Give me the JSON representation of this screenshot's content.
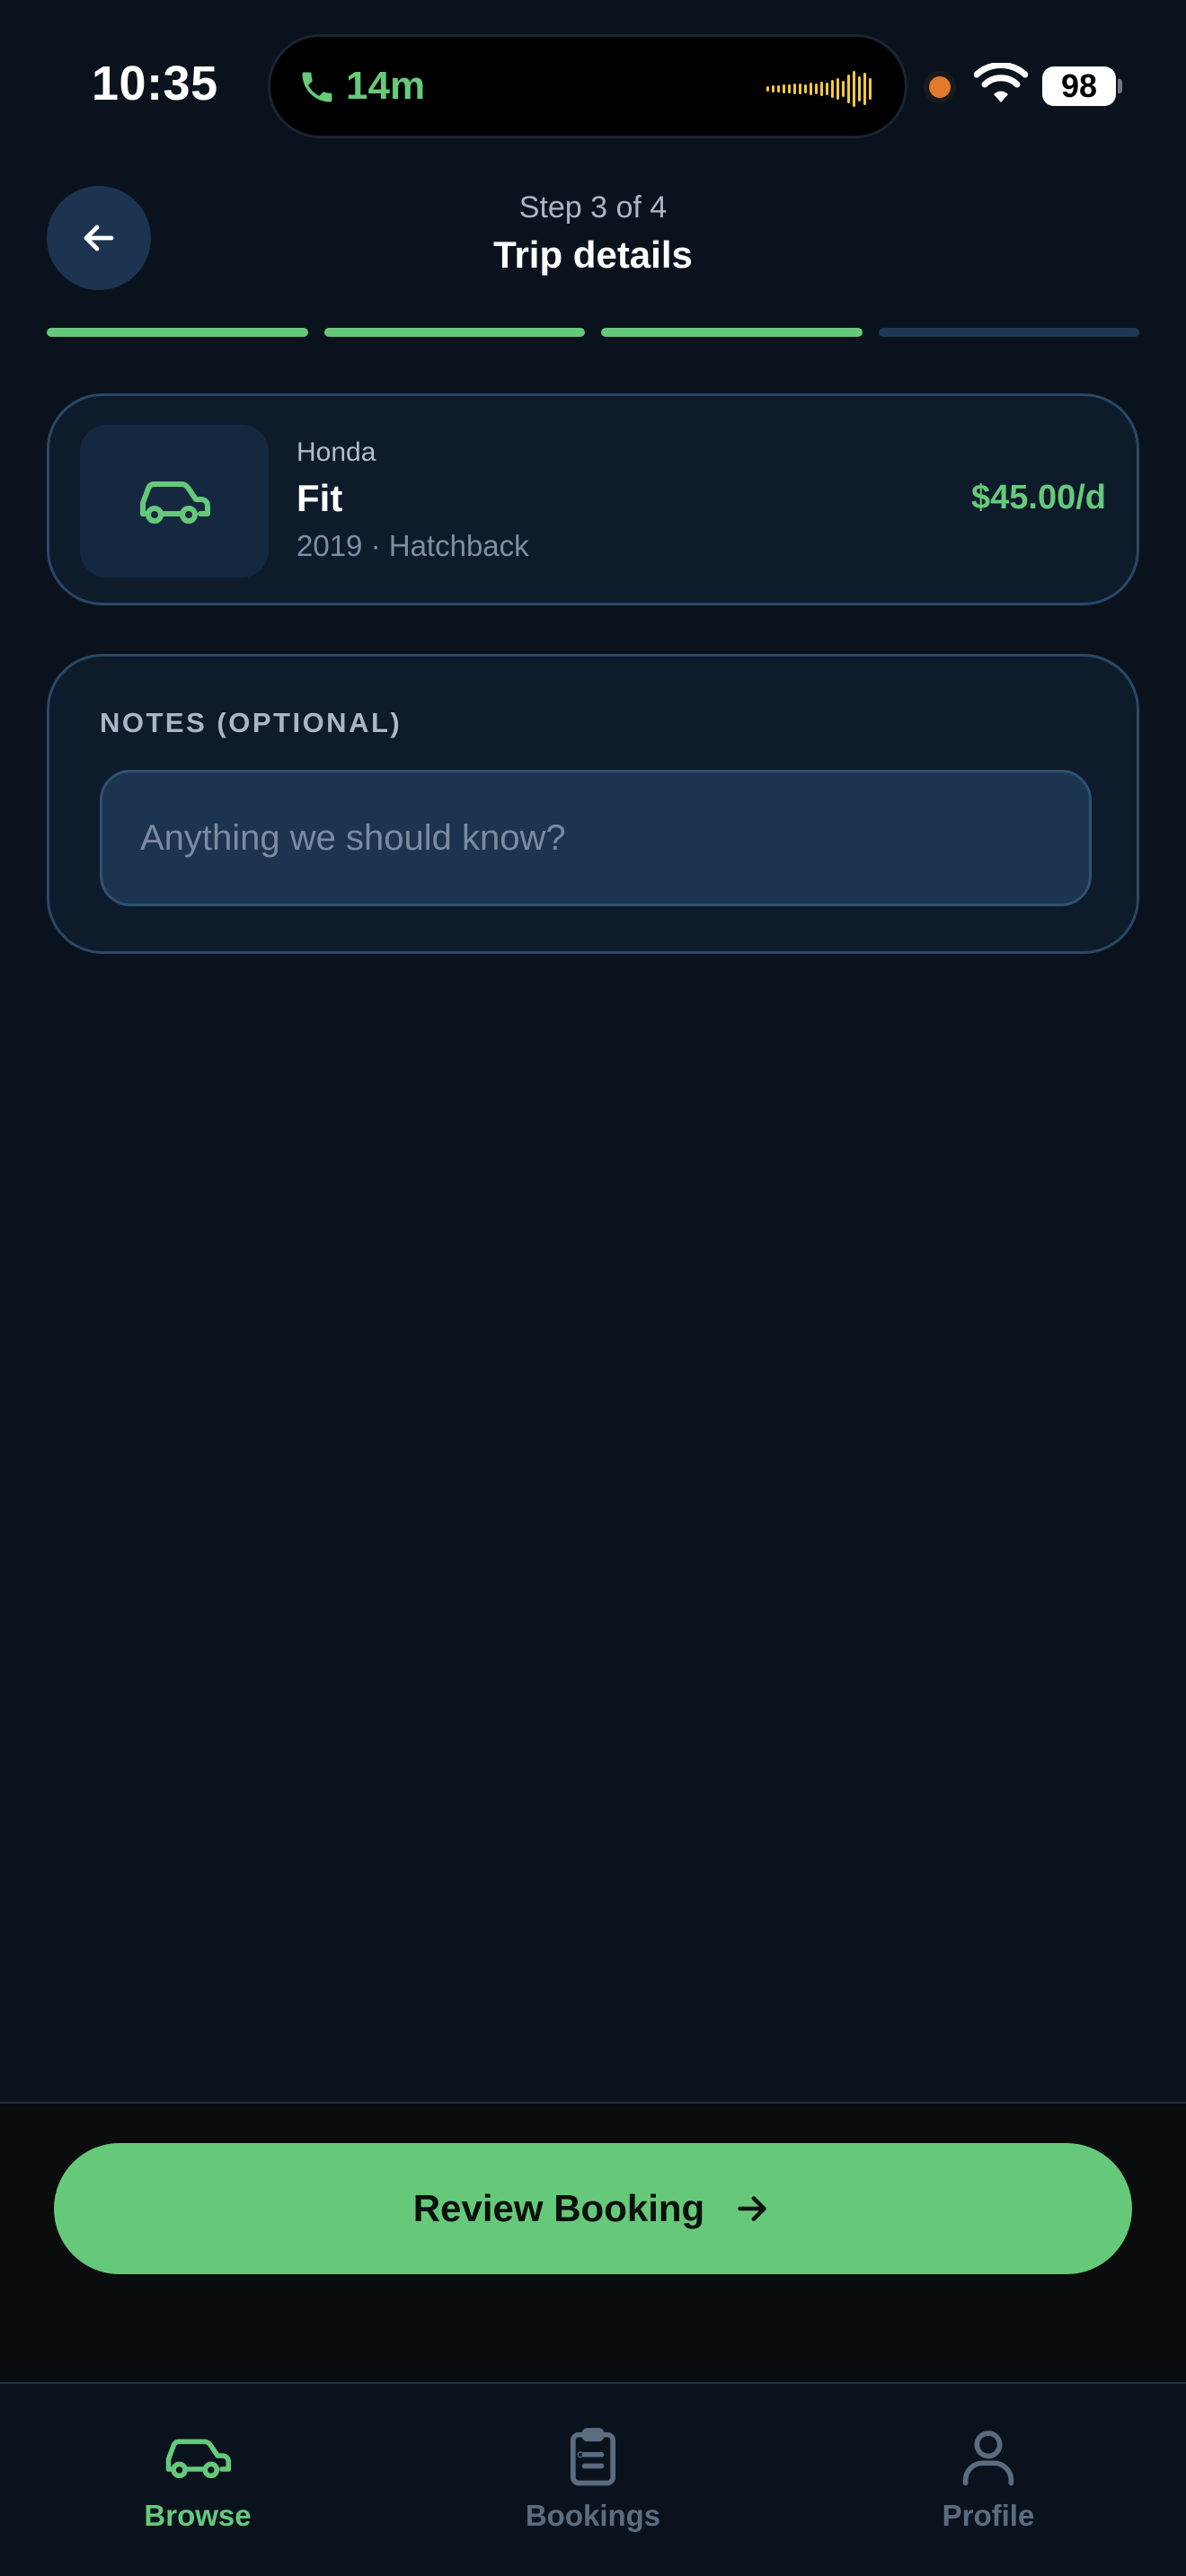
{
  "status_bar": {
    "time": "10:35",
    "call_duration": "14m",
    "battery": "98",
    "icons": [
      "phone-icon",
      "waveform-icon",
      "wifi-icon",
      "battery-icon"
    ]
  },
  "header": {
    "step": "Step 3 of 4",
    "title": "Trip details",
    "back_icon": "arrow-left-icon"
  },
  "progress": {
    "total_steps": 4,
    "completed_steps": 3,
    "colors": {
      "done": "#66c97a",
      "pending": "#1e3854"
    }
  },
  "vehicle": {
    "make": "Honda",
    "model": "Fit",
    "meta": "2019 · Hatchback",
    "price": "$45.00/d",
    "icon": "car-icon"
  },
  "notes": {
    "label": "NOTES (OPTIONAL)",
    "placeholder": "Anything we should know?",
    "value": ""
  },
  "actions": {
    "review_label": "Review Booking",
    "review_icon": "arrow-right-icon"
  },
  "tabs": [
    {
      "label": "Browse",
      "icon": "car-icon",
      "active": true
    },
    {
      "label": "Bookings",
      "icon": "clipboard-icon",
      "active": false
    },
    {
      "label": "Profile",
      "icon": "user-icon",
      "active": false
    }
  ],
  "colors": {
    "accent": "#66c97a",
    "background": "#0a131d",
    "card": "#0d1b2b",
    "card_border": "#2a4868"
  }
}
